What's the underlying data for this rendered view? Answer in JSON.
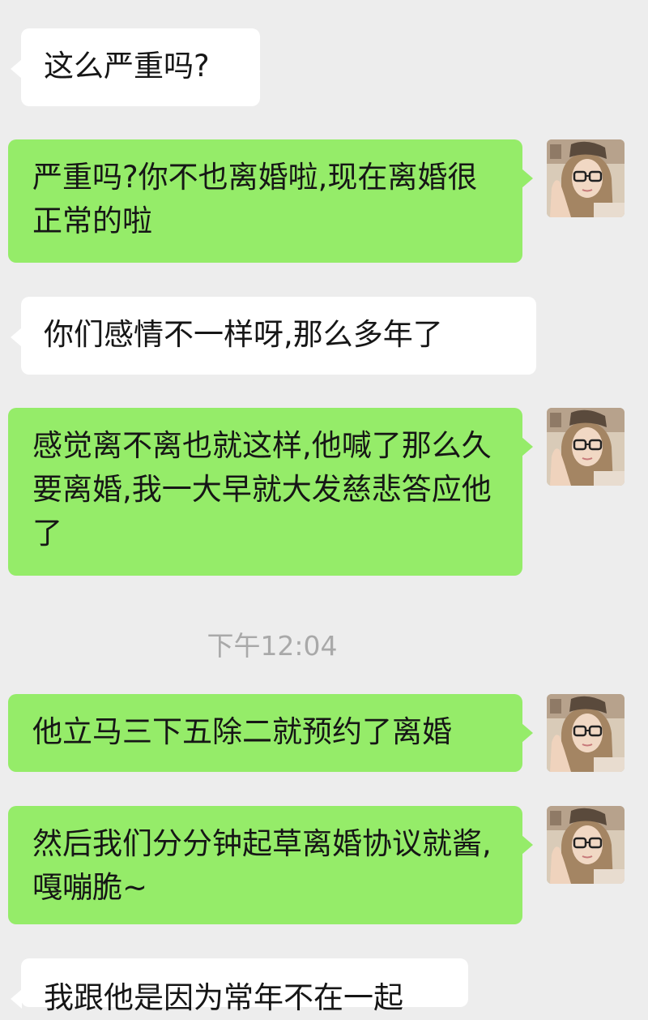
{
  "chat": {
    "messages": [
      {
        "side": "in",
        "text": "这么严重吗?"
      },
      {
        "side": "out",
        "text": "严重吗?你不也离婚啦,现在离婚很正常的啦"
      },
      {
        "side": "in",
        "text": "你们感情不一样呀,那么多年了"
      },
      {
        "side": "out",
        "text": "感觉离不离也就这样,他喊了那么久要离婚,我一大早就大发慈悲答应他了"
      },
      {
        "side": "out",
        "text": "他立马三下五除二就预约了离婚"
      },
      {
        "side": "out",
        "text": "然后我们分分钟起草离婚协议就酱,嘎嘣脆~"
      },
      {
        "side": "in",
        "text": "我跟他是因为常年不在一起"
      }
    ],
    "timestamp": "下午12:04"
  },
  "colors": {
    "background": "#ededed",
    "incoming_bubble": "#ffffff",
    "outgoing_bubble": "#95ec69",
    "timestamp_text": "#a9a9a9"
  }
}
